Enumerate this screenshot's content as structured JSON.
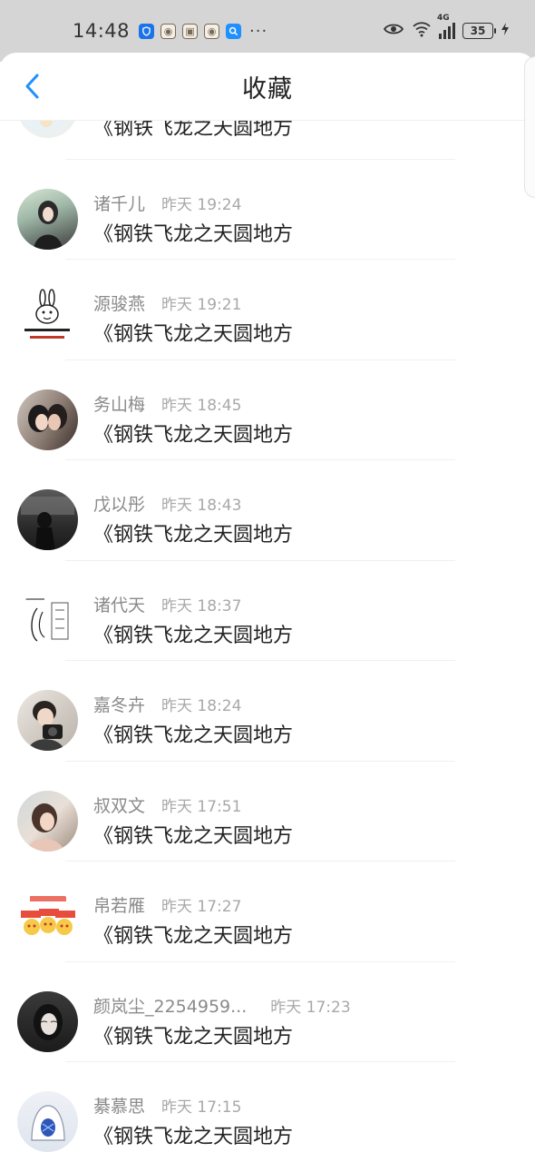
{
  "status_bar": {
    "time": "14:48",
    "network": "4G",
    "battery": "35",
    "icons": [
      "shield-icon",
      "app-icon",
      "app-icon",
      "app-icon",
      "search-icon",
      "more-icon",
      "eye-icon",
      "wifi-icon",
      "signal-icon",
      "battery-icon",
      "charging-icon"
    ]
  },
  "header": {
    "title": "收藏",
    "back_icon": "chevron-left-icon",
    "accent_color": "#1e90ff"
  },
  "items": [
    {
      "name": "",
      "time": "",
      "content": "《钢铁飞龙之天圆地方"
    },
    {
      "name": "诸千儿",
      "time": "昨天 19:24",
      "content": "《钢铁飞龙之天圆地方"
    },
    {
      "name": "源骏燕",
      "time": "昨天 19:21",
      "content": "《钢铁飞龙之天圆地方"
    },
    {
      "name": "务山梅",
      "time": "昨天 18:45",
      "content": "《钢铁飞龙之天圆地方"
    },
    {
      "name": "戊以彤",
      "time": "昨天 18:43",
      "content": "《钢铁飞龙之天圆地方"
    },
    {
      "name": "诸代天",
      "time": "昨天 18:37",
      "content": "《钢铁飞龙之天圆地方"
    },
    {
      "name": "嘉冬卉",
      "time": "昨天 18:24",
      "content": "《钢铁飞龙之天圆地方"
    },
    {
      "name": "叔双文",
      "time": "昨天 17:51",
      "content": "《钢铁飞龙之天圆地方"
    },
    {
      "name": "帛若雁",
      "time": "昨天 17:27",
      "content": "《钢铁飞龙之天圆地方"
    },
    {
      "name": "颜岚尘_2254959...",
      "time": "昨天 17:23",
      "content": "《钢铁飞龙之天圆地方"
    },
    {
      "name": "綦慕思",
      "time": "昨天 17:15",
      "content": "《钢铁飞龙之天圆地方"
    }
  ]
}
